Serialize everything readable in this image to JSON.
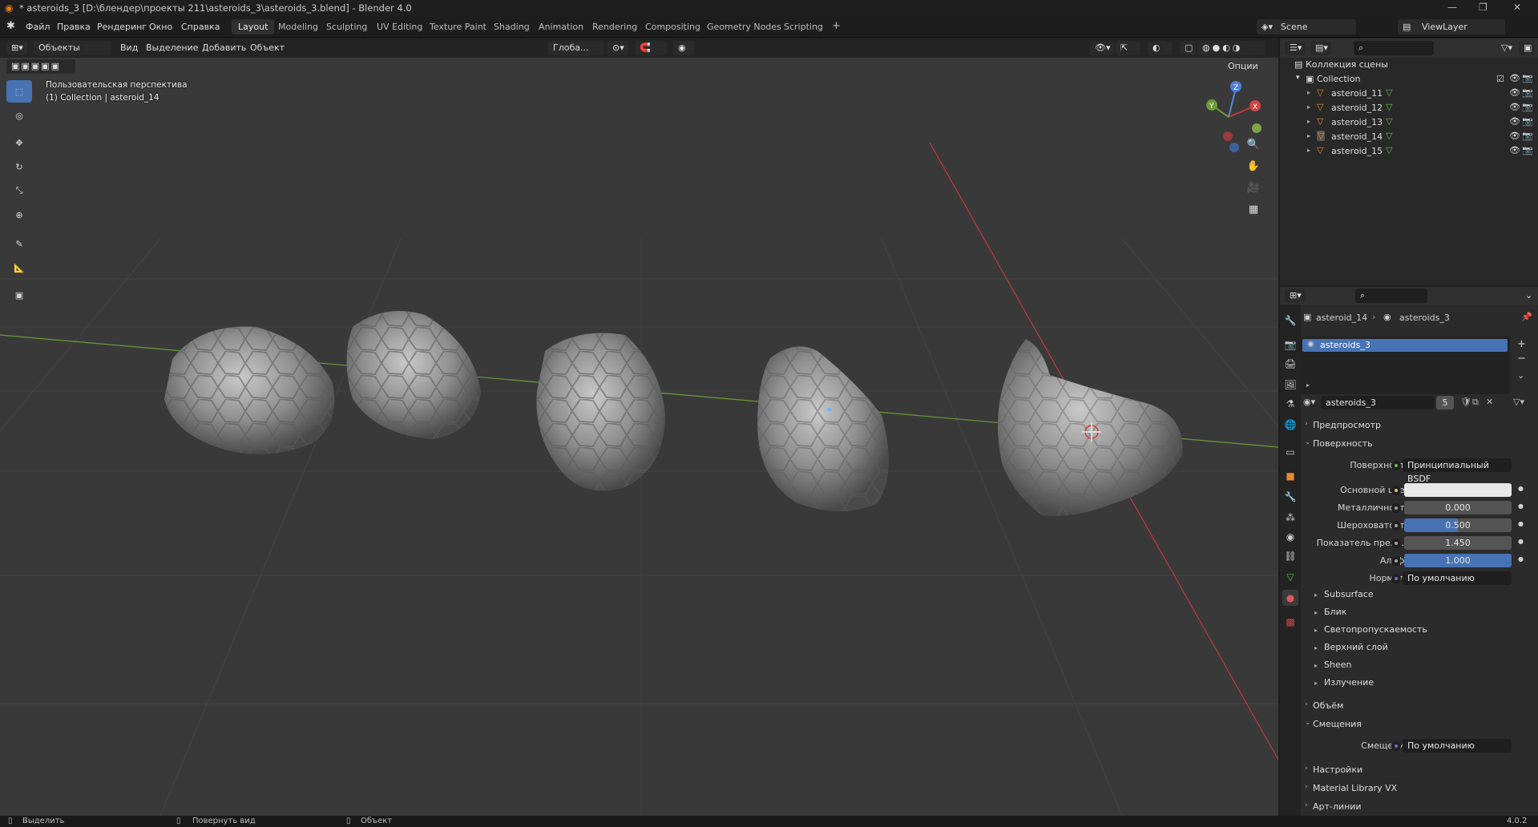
{
  "window": {
    "title": "* asteroids_3 [D:\\блендер\\проекты 211\\asteroids_3\\asteroids_3.blend] - Blender 4.0"
  },
  "menu": [
    "Файл",
    "Правка",
    "Рендеринг",
    "Окно",
    "Справка"
  ],
  "workspaces": [
    "Layout",
    "Modeling",
    "Sculpting",
    "UV Editing",
    "Texture Paint",
    "Shading",
    "Animation",
    "Rendering",
    "Compositing",
    "Geometry Nodes",
    "Scripting"
  ],
  "active_workspace": "Layout",
  "scene": {
    "label": "Scene",
    "viewlayer": "ViewLayer"
  },
  "viewport": {
    "mode": "Объекты",
    "menus": [
      "Вид",
      "Выделение",
      "Добавить",
      "Объект"
    ],
    "orientation": "Глоба...",
    "options": "Опции",
    "hud_line1": "Пользовательская перспектива",
    "hud_line2": "(1) Collection | asteroid_14"
  },
  "outliner": {
    "scene_collection": "Коллекция сцены",
    "collection": "Collection",
    "items": [
      "asteroid_11",
      "asteroid_12",
      "asteroid_13",
      "asteroid_14",
      "asteroid_15"
    ],
    "active_item": "asteroid_14"
  },
  "properties": {
    "breadcrumb_object": "asteroid_14",
    "breadcrumb_material": "asteroids_3",
    "slot": "asteroids_3",
    "material_name": "asteroids_3",
    "users": "5",
    "sections": {
      "preview": "Предпросмотр",
      "surface": "Поверхность",
      "volume": "Объём",
      "displacement": "Смещения",
      "settings": "Настройки",
      "matlib": "Material Library VX",
      "lineart": "Арт-линии"
    },
    "surface_label": "Поверхность",
    "surface_value": "Принципиальный BSDF",
    "base_color_label": "Основной цвет",
    "base_color": "#e8e8e8",
    "metallic_label": "Металличность",
    "metallic": "0.000",
    "roughness_label": "Шероховатость",
    "roughness": "0.500",
    "ior_label": "Показатель прело...",
    "ior": "1.450",
    "alpha_label": "Альфа",
    "alpha": "1.000",
    "normal_label": "Нормаль",
    "normal_value": "По умолчанию",
    "subpanels": [
      "Subsurface",
      "Блик",
      "Светопропускаемость",
      "Верхний слой",
      "Sheen",
      "Излучение"
    ],
    "disp_label": "Смещения",
    "disp_value": "По умолчанию"
  },
  "status": {
    "select": "Выделить",
    "rotate": "Повернуть вид",
    "object": "Объект",
    "version": "4.0.2"
  },
  "colors": {
    "accent": "#4772b3",
    "x_axis": "#c0393b",
    "y_axis": "#6c9a38"
  }
}
